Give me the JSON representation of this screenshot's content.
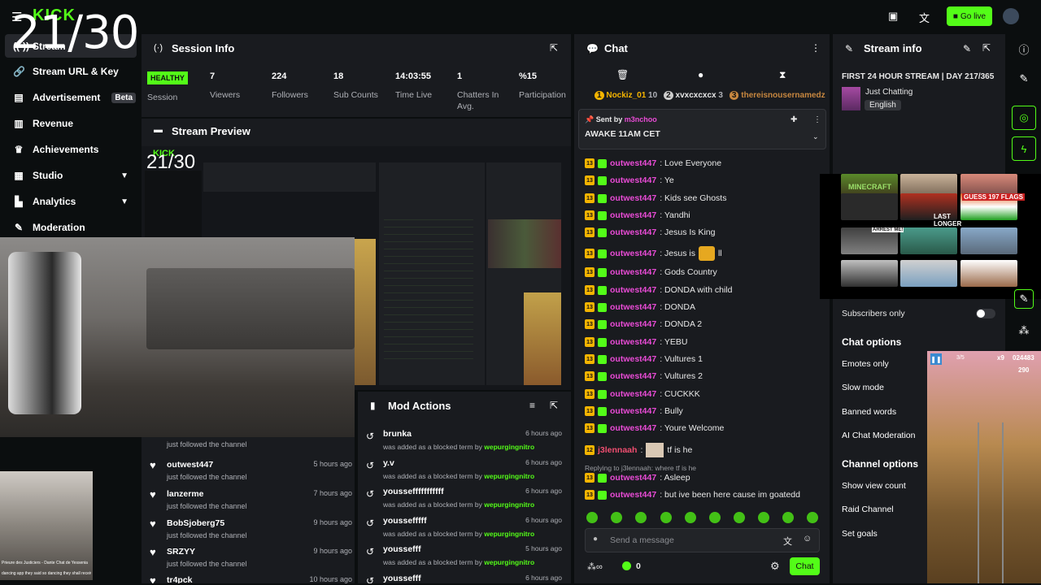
{
  "overlay_counter": "21/30",
  "topbar": {
    "logo": "KICK",
    "go_live": "Go live"
  },
  "sidebar": {
    "items": [
      {
        "label": "Stream",
        "icon": "broadcast-icon"
      },
      {
        "label": "Stream URL & Key",
        "icon": "link-icon"
      },
      {
        "label": "Advertisement",
        "badge": "Beta",
        "icon": "ad-icon"
      },
      {
        "label": "Revenue",
        "icon": "chart-icon"
      },
      {
        "label": "Achievements",
        "icon": "trophy-icon"
      },
      {
        "label": "Studio",
        "icon": "studio-icon"
      },
      {
        "label": "Analytics",
        "icon": "analytics-icon"
      },
      {
        "label": "Moderation",
        "icon": "wrench-icon"
      }
    ]
  },
  "session": {
    "title": "Session Info",
    "health": "HEALTHY",
    "health_label": "Session",
    "stats": [
      {
        "value": "7",
        "label": "Viewers"
      },
      {
        "value": "224",
        "label": "Followers"
      },
      {
        "value": "18",
        "label": "Sub Counts"
      },
      {
        "value": "14:03:55",
        "label": "Time Live"
      },
      {
        "value": "1",
        "label": "Chatters In Avg."
      },
      {
        "value": "%15",
        "label": "Participation"
      }
    ]
  },
  "preview": {
    "title": "Stream Preview"
  },
  "followers": [
    {
      "name": "",
      "desc": "just followed the channel",
      "time": ""
    },
    {
      "name": "outwest447",
      "desc": "just followed the channel",
      "time": "5 hours ago"
    },
    {
      "name": "lanzerme",
      "desc": "just followed the channel",
      "time": "7 hours ago"
    },
    {
      "name": "BobSjoberg75",
      "desc": "just followed the channel",
      "time": "9 hours ago"
    },
    {
      "name": "SRZYY",
      "desc": "just followed the channel",
      "time": "9 hours ago"
    },
    {
      "name": "tr4pck",
      "desc": "",
      "time": "10 hours ago"
    }
  ],
  "mod_actions": {
    "title": "Mod Actions",
    "desc_prefix": "was added as a blocked term by",
    "moderator": "wepurgingnitro",
    "rows": [
      {
        "term": "brunka",
        "time": "6 hours ago"
      },
      {
        "term": "y.v",
        "time": "6 hours ago"
      },
      {
        "term": "youssefffffffffff",
        "time": "6 hours ago"
      },
      {
        "term": "youssefffff",
        "time": "6 hours ago"
      },
      {
        "term": "youssefff",
        "time": "5 hours ago"
      },
      {
        "term": "youssefff",
        "time": "6 hours ago"
      }
    ]
  },
  "chat": {
    "title": "Chat",
    "top_chatters": [
      {
        "rank": "1",
        "name": "Nockiz_01",
        "count": "10"
      },
      {
        "rank": "2",
        "name": "xvxcxcxcx",
        "count": "3"
      },
      {
        "rank": "3",
        "name": "thereisnousernamedz",
        "count": ""
      }
    ],
    "pinned": {
      "sent_by": "Sent by",
      "user": "m3nchoo",
      "message": "AWAKE 11AM CET"
    },
    "messages": [
      {
        "user": "outwest447",
        "text": ": Love Everyone"
      },
      {
        "user": "outwest447",
        "text": ": Ye"
      },
      {
        "user": "outwest447",
        "text": ": Kids see Ghosts"
      },
      {
        "user": "outwest447",
        "text": ": Yandhi"
      },
      {
        "user": "outwest447",
        "text": ": Jesus Is King"
      },
      {
        "user": "outwest447",
        "text": ": Jesus is",
        "suffix": "ll"
      },
      {
        "user": "outwest447",
        "text": ": Gods Country"
      },
      {
        "user": "outwest447",
        "text": ": DONDA with child"
      },
      {
        "user": "outwest447",
        "text": ": DONDA"
      },
      {
        "user": "outwest447",
        "text": ": DONDA 2"
      },
      {
        "user": "outwest447",
        "text": ": YEBU"
      },
      {
        "user": "outwest447",
        "text": ": Vultures 1"
      },
      {
        "user": "outwest447",
        "text": ": Vultures 2"
      },
      {
        "user": "outwest447",
        "text": ": CUCKKK"
      },
      {
        "user": "outwest447",
        "text": ": Bully"
      },
      {
        "user": "outwest447",
        "text": ": Youre Welcome"
      }
    ],
    "j3_user": "j3lennaah",
    "j3_text": "tf is he",
    "reply_note": "Replying to j3lennaah: where tf is he",
    "after": [
      {
        "user": "outwest447",
        "text": ": Asleep"
      },
      {
        "user": "outwest447",
        "text": ": but ive been here cause im goatedd"
      }
    ],
    "placeholder": "Send a message",
    "count": "0",
    "send": "Chat"
  },
  "stream_info": {
    "title": "Stream info",
    "stream_title": "FIRST 24 HOUR STREAM | DAY 217/365",
    "category": "Just Chatting",
    "language": "English",
    "subscribers_only": "Subscribers only",
    "chat_options_title": "Chat options",
    "chat_options": [
      "Emotes only",
      "Slow mode",
      "Banned words",
      "AI Chat Moderation"
    ],
    "channel_options_title": "Channel options",
    "channel_options": [
      "Show view count",
      "Raid Channel",
      "Set goals"
    ]
  },
  "overlays": {
    "thumb_labels": [
      "MINECRAFT",
      "GUESS 197 FLAGS",
      "LAST LONGER NOW",
      "ARREST ME!"
    ],
    "game_score": "024483",
    "game_coins": "290",
    "game_mult": "x9",
    "game_level": "3/5",
    "pip_caption": "Prieure des Justiciers - Dante Chat de Yessenia",
    "pip_caption2": "dancing app they said so dancing they shall receive..."
  },
  "colors": {
    "accent": "#53fc18",
    "username": "#e94bd6",
    "panel": "#191b1f",
    "bg": "#0b0e0f"
  }
}
